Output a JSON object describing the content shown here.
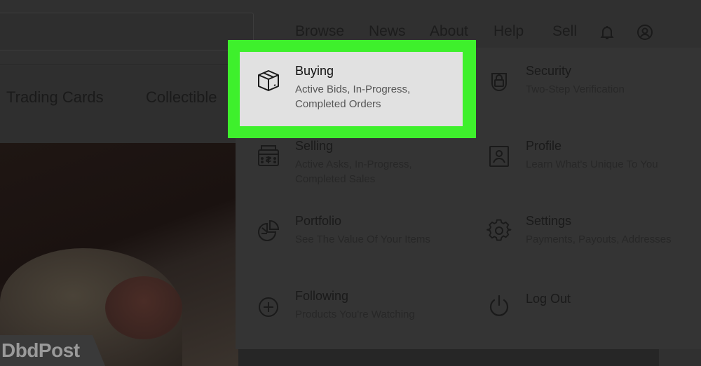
{
  "nav": {
    "browse": "Browse",
    "news": "News",
    "about": "About",
    "help": "Help",
    "sell": "Sell",
    "bell_icon": "bell-icon",
    "user_icon": "user-icon"
  },
  "categories": [
    "Trading Cards",
    "Collectible"
  ],
  "menu": {
    "buying": {
      "title": "Buying",
      "subtitle": "Active Bids, In-Progress, Completed Orders",
      "icon": "box-icon"
    },
    "selling": {
      "title": "Selling",
      "subtitle": "Active Asks, In-Progress, Completed Sales",
      "icon": "cash-register-icon"
    },
    "portfolio": {
      "title": "Portfolio",
      "subtitle": "See The Value Of Your Items",
      "icon": "pie-chart-icon"
    },
    "following": {
      "title": "Following",
      "subtitle": "Products You're Watching",
      "icon": "plus-circle-icon"
    },
    "security": {
      "title": "Security",
      "subtitle": "Two-Step Verification",
      "icon": "shield-lock-icon"
    },
    "profile": {
      "title": "Profile",
      "subtitle": "Learn What's Unique To You",
      "icon": "profile-card-icon"
    },
    "settings": {
      "title": "Settings",
      "subtitle": "Payments, Payouts, Addresses",
      "icon": "gear-icon"
    },
    "logout": {
      "title": "Log Out",
      "icon": "power-icon"
    }
  },
  "highlight_color": "#3ef02c",
  "watermark": "DbdPost"
}
